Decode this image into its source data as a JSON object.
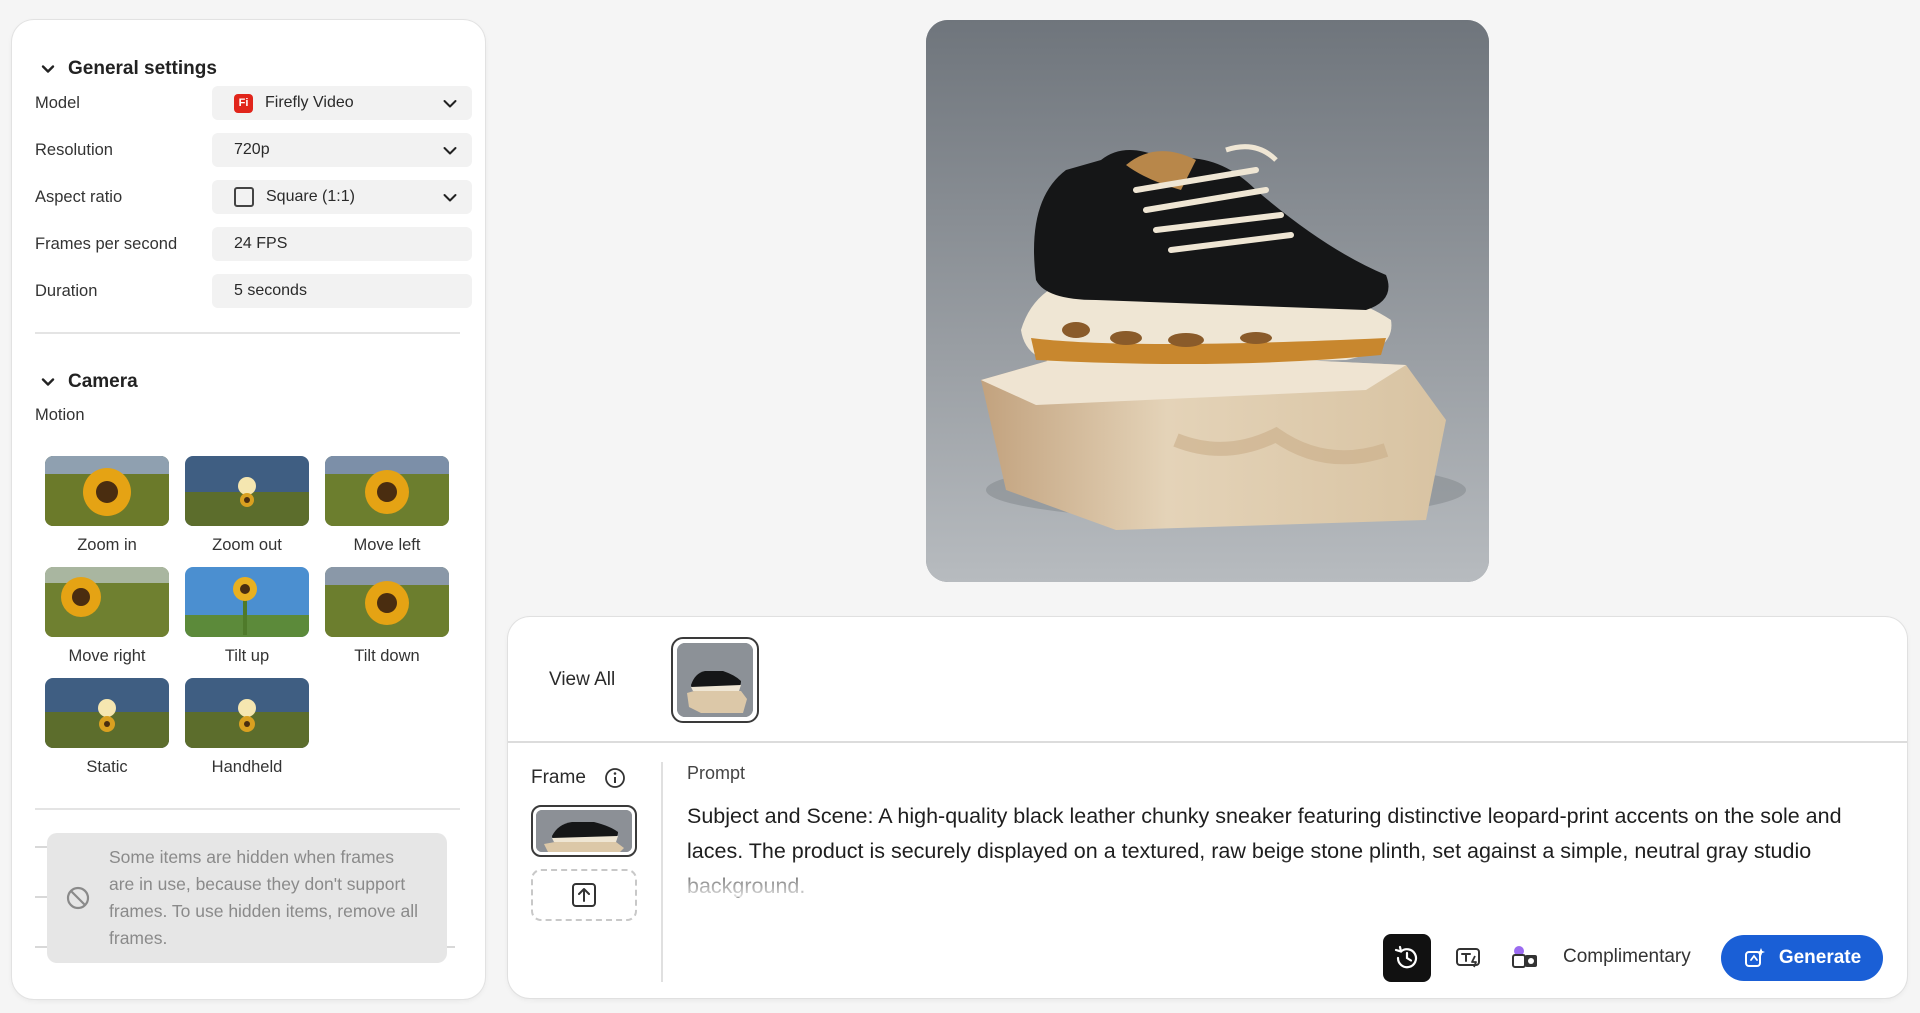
{
  "general_settings": {
    "title": "General settings",
    "model": {
      "label": "Model",
      "value": "Firefly Video",
      "logo_text": "Fi"
    },
    "resolution": {
      "label": "Resolution",
      "value": "720p"
    },
    "aspect_ratio": {
      "label": "Aspect ratio",
      "value": "Square (1:1)"
    },
    "fps": {
      "label": "Frames per second",
      "value": "24 FPS"
    },
    "duration": {
      "label": "Duration",
      "value": "5 seconds"
    }
  },
  "camera": {
    "title": "Camera",
    "motion_label": "Motion",
    "motions": [
      {
        "label": "Zoom in"
      },
      {
        "label": "Zoom out"
      },
      {
        "label": "Move left"
      },
      {
        "label": "Move right"
      },
      {
        "label": "Tilt up"
      },
      {
        "label": "Tilt down"
      },
      {
        "label": "Static"
      },
      {
        "label": "Handheld"
      }
    ]
  },
  "notice": {
    "text": "Some items are hidden when frames are in use, because they don't support frames. To use hidden items, remove all frames."
  },
  "bottom": {
    "view_all": "View All",
    "frame_label": "Frame",
    "prompt_label": "Prompt",
    "prompt_text": "Subject and Scene: A high-quality black leather chunky sneaker featuring distinctive leopard-print accents on the sole and laces. The product is securely displayed on a textured, raw beige stone plinth, set against a simple, neutral gray studio background.",
    "complimentary": "Complimentary",
    "generate": "Generate"
  },
  "colors": {
    "accent": "#1a5fd6",
    "firefly_logo": "#e1251b"
  }
}
